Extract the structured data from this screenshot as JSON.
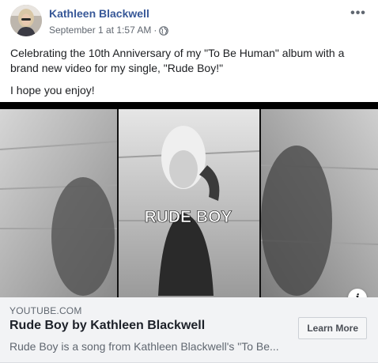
{
  "post": {
    "author": "Kathleen Blackwell",
    "timestamp": "September 1 at 1:57 AM",
    "separator": "·",
    "privacy_icon": "globe-icon",
    "more_label": "•••",
    "paragraphs": [
      "Celebrating the 10th Anniversary of my \"To Be Human\" album with a brand new video for my single, \"Rude Boy!\"",
      "I hope you enjoy!"
    ]
  },
  "link_card": {
    "video_overlay_text": "RUDE BOY",
    "info_label": "i",
    "domain": "YOUTUBE.COM",
    "title": "Rude Boy by Kathleen Blackwell",
    "description": "Rude Boy is a song from Kathleen Blackwell's \"To Be...",
    "cta_label": "Learn More"
  },
  "colors": {
    "author_link": "#385898",
    "meta_text": "#606770",
    "card_footer_bg": "#f2f3f5"
  }
}
